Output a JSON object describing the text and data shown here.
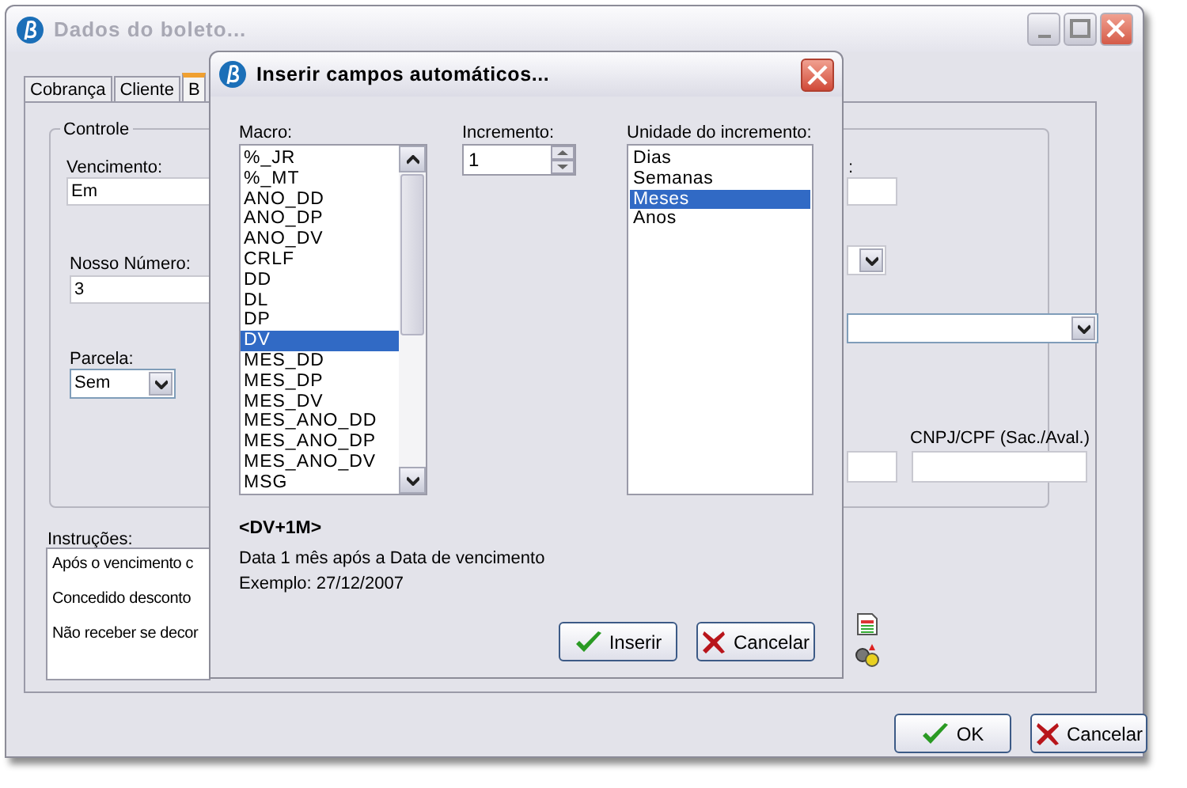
{
  "window": {
    "title": "Dados do boleto..."
  },
  "tabs": [
    {
      "label": "Cobrança",
      "selected": false
    },
    {
      "label": "Cliente",
      "selected": false
    },
    {
      "label": "B",
      "selected": true
    }
  ],
  "controle": {
    "title": "Controle",
    "vencimento": {
      "label": "Vencimento:",
      "value": "Em"
    },
    "nosso_numero": {
      "label": "Nosso Número:",
      "value": "3"
    },
    "parcela": {
      "label": "Parcela:",
      "value": "Sem"
    },
    "hidden_label_tail": ":",
    "cnpj": {
      "label": "CNPJ/CPF (Sac./Aval.)"
    }
  },
  "instrucoes": {
    "label": "Instruções:",
    "lines": [
      "Após o vencimento c",
      "Concedido desconto",
      "Não receber se decor"
    ]
  },
  "buttons": [
    {
      "label": "OK",
      "kind": "ok"
    },
    {
      "label": "Cancelar",
      "kind": "cancel"
    }
  ],
  "dialog": {
    "title": "Inserir campos automáticos...",
    "macro": {
      "label": "Macro:",
      "items": [
        {
          "label": "%_JR",
          "selected": false
        },
        {
          "label": "%_MT",
          "selected": false
        },
        {
          "label": "ANO_DD",
          "selected": false
        },
        {
          "label": "ANO_DP",
          "selected": false
        },
        {
          "label": "ANO_DV",
          "selected": false
        },
        {
          "label": "CRLF",
          "selected": false
        },
        {
          "label": "DD",
          "selected": false
        },
        {
          "label": "DL",
          "selected": false
        },
        {
          "label": "DP",
          "selected": false
        },
        {
          "label": "DV",
          "selected": true
        },
        {
          "label": "MES_DD",
          "selected": false
        },
        {
          "label": "MES_DP",
          "selected": false
        },
        {
          "label": "MES_DV",
          "selected": false
        },
        {
          "label": "MES_ANO_DD",
          "selected": false
        },
        {
          "label": "MES_ANO_DP",
          "selected": false
        },
        {
          "label": "MES_ANO_DV",
          "selected": false
        },
        {
          "label": "MSG",
          "selected": false
        }
      ]
    },
    "incremento": {
      "label": "Incremento:",
      "value": "1"
    },
    "unidade": {
      "label": "Unidade do incremento:",
      "items": [
        {
          "label": "Dias",
          "selected": false
        },
        {
          "label": "Semanas",
          "selected": false
        },
        {
          "label": "Meses",
          "selected": true
        },
        {
          "label": "Anos",
          "selected": false
        }
      ]
    },
    "preview": {
      "code": "<DV+1M>",
      "description": "Data 1 mês após a Data de vencimento",
      "example": "Exemplo: 27/12/2007"
    },
    "buttons": [
      {
        "label": "Inserir",
        "kind": "ok"
      },
      {
        "label": "Cancelar",
        "kind": "cancel"
      }
    ]
  }
}
